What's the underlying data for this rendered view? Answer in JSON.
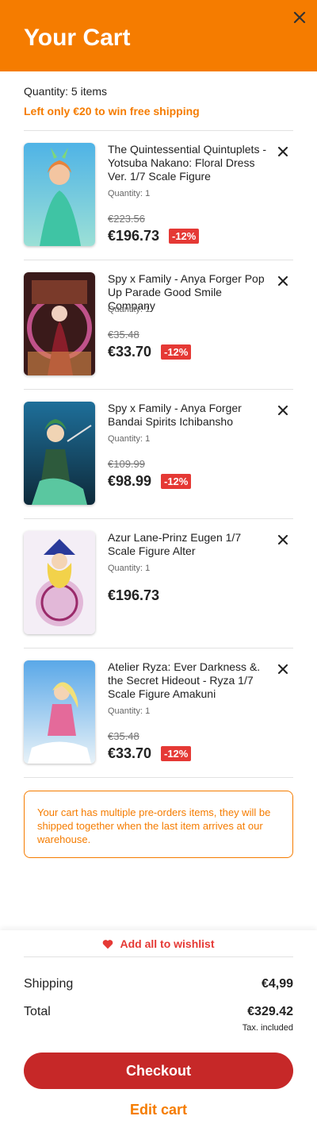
{
  "header": {
    "title": "Your Cart",
    "close_icon": "close-icon"
  },
  "summary": {
    "quantity_text": "Quantity: 5 items",
    "shipping_notice": "Left only €20 to win free shipping"
  },
  "items": [
    {
      "name": "The Quintessential Quintuplets - Yotsuba Nakano: Floral Dress Ver. 1/7 Scale Figure",
      "quantity": "Quantity: 1",
      "old_price": "€223.56",
      "price": "€196.73",
      "discount": "-12%"
    },
    {
      "name": "Spy x Family - Anya Forger Pop Up Parade Good Smile Company",
      "quantity": "Quantity: 1",
      "old_price": "€35.48",
      "price": "€33.70",
      "discount": "-12%"
    },
    {
      "name": "Spy x Family - Anya Forger Bandai Spirits Ichibansho",
      "quantity": "Quantity: 1",
      "old_price": "€109.99",
      "price": "€98.99",
      "discount": "-12%"
    },
    {
      "name": "Azur Lane-Prinz Eugen 1/7 Scale Figure Alter",
      "quantity": "Quantity: 1",
      "old_price": null,
      "price": "€196.73",
      "discount": null
    },
    {
      "name": "Atelier Ryza: Ever Darkness &. the Secret Hideout - Ryza 1/7 Scale Figure Amakuni",
      "quantity": "Quantity: 1",
      "old_price": "€35.48",
      "price": "€33.70",
      "discount": "-12%"
    }
  ],
  "notice": "Your cart has multiple pre-orders items, they will be shipped together when the last item arrives at our warehouse.",
  "footer": {
    "wishlist_label": "Add all to wishlist",
    "shipping_label": "Shipping",
    "shipping_value": "€4,99",
    "total_label": "Total",
    "total_value": "€329.42",
    "tax_note": "Tax. included",
    "checkout_label": "Checkout",
    "edit_label": "Edit cart"
  },
  "colors": {
    "brand_orange": "#f57c00",
    "discount_red": "#e53935",
    "checkout_red": "#c62828"
  }
}
